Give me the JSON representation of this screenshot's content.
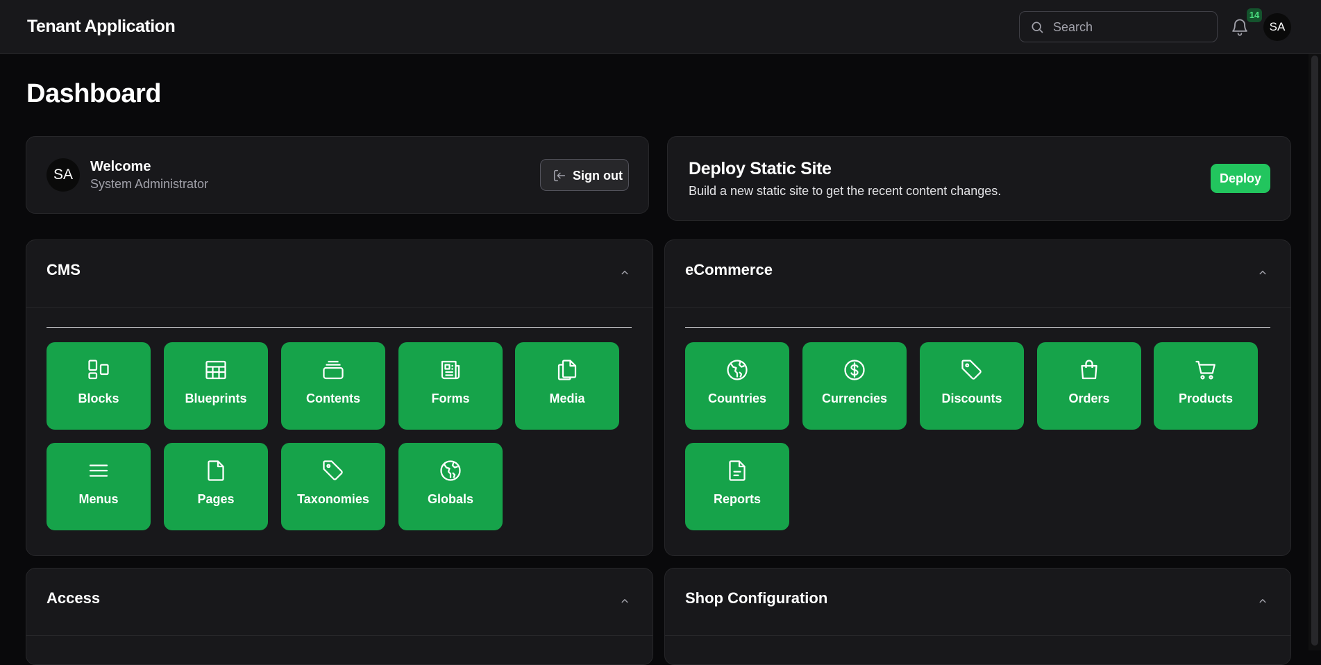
{
  "app": {
    "title": "Tenant Application"
  },
  "search": {
    "placeholder": "Search"
  },
  "notifications": {
    "count": "14"
  },
  "user": {
    "initials": "SA"
  },
  "page": {
    "title": "Dashboard"
  },
  "welcome": {
    "title": "Welcome",
    "role": "System Administrator",
    "avatar_initials": "SA",
    "signout_label": "Sign out"
  },
  "deploy": {
    "title": "Deploy Static Site",
    "description": "Build a new static site to get the recent content changes.",
    "button_label": "Deploy"
  },
  "cms": {
    "title": "CMS",
    "tiles": [
      {
        "label": "Blocks",
        "icon": "blocks-icon"
      },
      {
        "label": "Blueprints",
        "icon": "table-icon"
      },
      {
        "label": "Contents",
        "icon": "stack-icon"
      },
      {
        "label": "Forms",
        "icon": "newspaper-icon"
      },
      {
        "label": "Media",
        "icon": "documents-icon"
      },
      {
        "label": "Menus",
        "icon": "menu-icon"
      },
      {
        "label": "Pages",
        "icon": "file-icon"
      },
      {
        "label": "Taxonomies",
        "icon": "tag-icon"
      },
      {
        "label": "Globals",
        "icon": "globe-icon"
      }
    ]
  },
  "ecommerce": {
    "title": "eCommerce",
    "tiles": [
      {
        "label": "Countries",
        "icon": "globe-icon"
      },
      {
        "label": "Currencies",
        "icon": "dollar-icon"
      },
      {
        "label": "Discounts",
        "icon": "tag-icon"
      },
      {
        "label": "Orders",
        "icon": "shopping-bag-icon"
      },
      {
        "label": "Products",
        "icon": "cart-icon"
      },
      {
        "label": "Reports",
        "icon": "report-icon"
      }
    ]
  },
  "access": {
    "title": "Access"
  },
  "shop_config": {
    "title": "Shop Configuration"
  },
  "colors": {
    "background": "#09090b",
    "card": "#18181b",
    "tile": "#16a34a",
    "deploy_button": "#22c55e"
  }
}
